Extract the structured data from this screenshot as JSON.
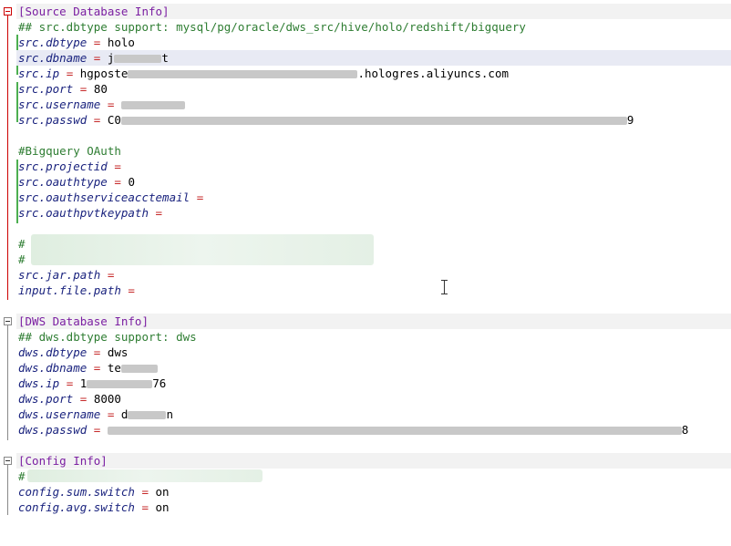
{
  "editor": {
    "source_section": {
      "header": "[Source Database Info]",
      "support_comment": "## src.dbtype support: mysql/pg/oracle/dws_src/hive/holo/redshift/bigquery",
      "lines": [
        {
          "key": "src.dbtype",
          "value": "holo"
        },
        {
          "key": "src.dbname",
          "value": "j",
          "tail": "t"
        },
        {
          "key": "src.ip",
          "value": "hgposte",
          "tail": ".hologres.aliyuncs.com"
        },
        {
          "key": "src.port",
          "value": "80"
        },
        {
          "key": "src.username",
          "value": ""
        },
        {
          "key": "src.passwd",
          "value": "C0",
          "tail": "9"
        }
      ],
      "bigquery_comment": "#Bigquery OAuth",
      "bigquery_lines": [
        {
          "key": "src.projectid",
          "value": ""
        },
        {
          "key": "src.oauthtype",
          "value": "0"
        },
        {
          "key": "src.oauthserviceacctemail",
          "value": ""
        },
        {
          "key": "src.oauthpvtkeypath",
          "value": ""
        }
      ],
      "hash1": "#",
      "hash2": "#",
      "jar_lines": [
        {
          "key": "src.jar.path",
          "value": ""
        },
        {
          "key": "input.file.path",
          "value": ""
        }
      ]
    },
    "dws_section": {
      "header": "[DWS Database Info]",
      "support_comment": "## dws.dbtype support: dws",
      "lines": [
        {
          "key": "dws.dbtype",
          "value": "dws"
        },
        {
          "key": "dws.dbname",
          "value": "te"
        },
        {
          "key": "dws.ip",
          "value": "1",
          "tail": "76"
        },
        {
          "key": "dws.port",
          "value": "8000"
        },
        {
          "key": "dws.username",
          "value": "d",
          "tail": "n"
        },
        {
          "key": "dws.passwd",
          "value": "",
          "tail": "8"
        }
      ]
    },
    "config_section": {
      "header": "[Config Info]",
      "hash": "#",
      "lines": [
        {
          "key": "config.sum.switch",
          "value": "on"
        },
        {
          "key": "config.avg.switch",
          "value": "on"
        }
      ]
    },
    "equals": "="
  }
}
